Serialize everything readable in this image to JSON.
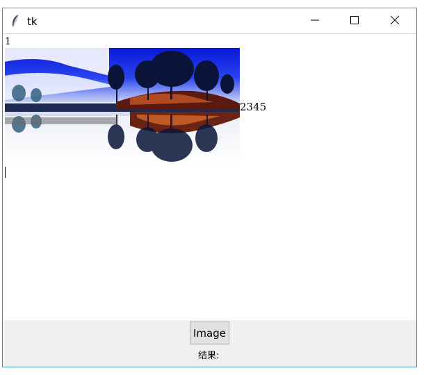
{
  "window": {
    "title": "tk"
  },
  "text_area": {
    "first_line": "1",
    "inline_text": "2345"
  },
  "image_button": {
    "label": "Image"
  },
  "result_label": "结果:",
  "colors": {
    "window_border": "#3a8fb0",
    "bottom_bg": "#f0f0f0",
    "button_bg": "#e1e1e1"
  },
  "icons": [
    "feather-icon",
    "minimize-icon",
    "maximize-icon",
    "close-icon"
  ]
}
